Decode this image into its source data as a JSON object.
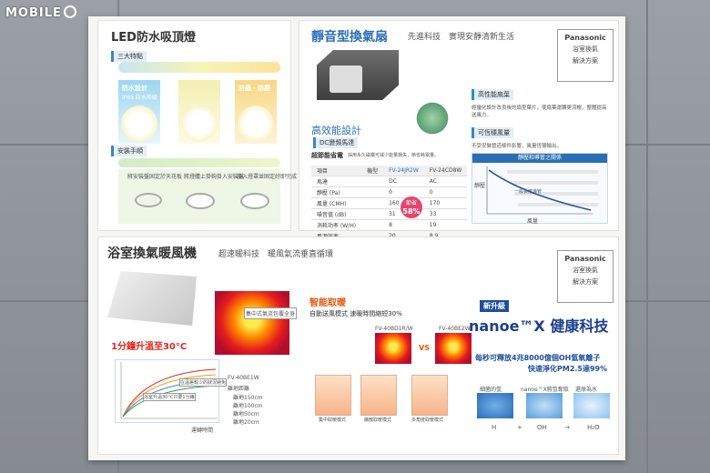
{
  "watermark": "MOBILE",
  "led": {
    "title": "LED防水吸頂燈",
    "features_tag": "三大特點",
    "features": [
      "防水設計",
      "",
      "防蟲・防塵"
    ],
    "features_sub": [
      "IP65 防水等級",
      "",
      ""
    ],
    "install_tag": "安裝手順",
    "install_steps": [
      "將安裝盤固定於天花板",
      "將燈體上掛鉤掛入安裝盤",
      "旋入燈罩並固定好即完成"
    ]
  },
  "fan": {
    "title": "靜音型換氣扇",
    "tagline": "先進科技　實現安靜清新生活",
    "brand": "Panasonic",
    "brand_lines": [
      "浴室換氣",
      "解決方案"
    ],
    "eff_title": "高效能設計",
    "dc_tag": "DC變頻馬達",
    "eff_desc": "超節能省電",
    "eff_note": "採用永久磁鐵可減少能量損失，節省耗電量。",
    "spec": {
      "header": [
        "項目",
        "機型",
        "FV-24JR2W",
        "FV-24CD8W"
      ],
      "rows": [
        [
          "馬達",
          "",
          "DC",
          "AC"
        ],
        [
          "靜壓 (Pa)",
          "",
          "0",
          "0"
        ],
        [
          "風量 (CMH)",
          "",
          "160",
          "170"
        ],
        [
          "噪音值 (dB)",
          "",
          "31",
          "33"
        ],
        [
          "消耗功率 (W/H)",
          "",
          "8",
          "19"
        ],
        [
          "風源效率",
          "",
          "20",
          "8.9"
        ]
      ],
      "saving_label": "節省",
      "saving_value": "58%"
    },
    "blade_tag": "高性能扇葉",
    "blade_desc": "經優化設計改良後的扇型葉片，使扇葉運轉更流暢，整體提高送風力。",
    "fixed_tag": "可恆穩風量",
    "fixed_desc": "不受安裝管道條件影響，風量恆穩輸出。",
    "fixed_chart": {
      "title": "靜壓和導管之關係",
      "ylabel": "靜壓",
      "xlabel": "風量",
      "rows": [
        "",
        "一般長度導管",
        "",
        "",
        ""
      ]
    }
  },
  "heater": {
    "title": "浴室換氣暖風機",
    "tagline": "超速暖科技　暖風氣流垂直循環",
    "brand": "Panasonic",
    "brand_lines": [
      "浴室換氣",
      "解決方案"
    ],
    "heat_caption": "1分鐘升溫至30°C",
    "model": "FV-40BE1W",
    "thermal_label": "集中式氣流包覆全身",
    "thermal_note": "",
    "chart_notes": [
      "浴室升溫30°C只要1分鐘",
      "在溫差較少的狀況避免"
    ],
    "chart_legend": [
      "離地150cm",
      "離地100cm",
      "離地50cm",
      "離地20cm"
    ],
    "chart_legend_title": "離地距離",
    "chart_xlabel": "運轉時間",
    "smart_title": "智能取暖",
    "smart_sub": "自動送風模式 速暖時間縮短30%",
    "compare_models": [
      "FV-40BD1R/W",
      "VS",
      "FV-40BE2W"
    ],
    "mode_labels": [
      "集中取暖模式",
      "擴散取暖模式",
      "多角度取暖模式"
    ],
    "mode_notes": [
      "",
      "",
      ""
    ],
    "nanoe_badge": "新升級",
    "nanoe_title": "nanoe™X 健康科技",
    "nanoe_line1": "每秒可釋放4兆8000億個OH氫氧離子",
    "nanoe_line2": "快速淨化PM2.5達99%",
    "nanoe_steps": [
      "細菌的氫",
      "nanoe™X將氫奪取",
      "還原為水"
    ],
    "nanoe_formula": [
      "H",
      "+",
      "OH",
      "→",
      "H₂O"
    ],
    "footnote": ""
  }
}
